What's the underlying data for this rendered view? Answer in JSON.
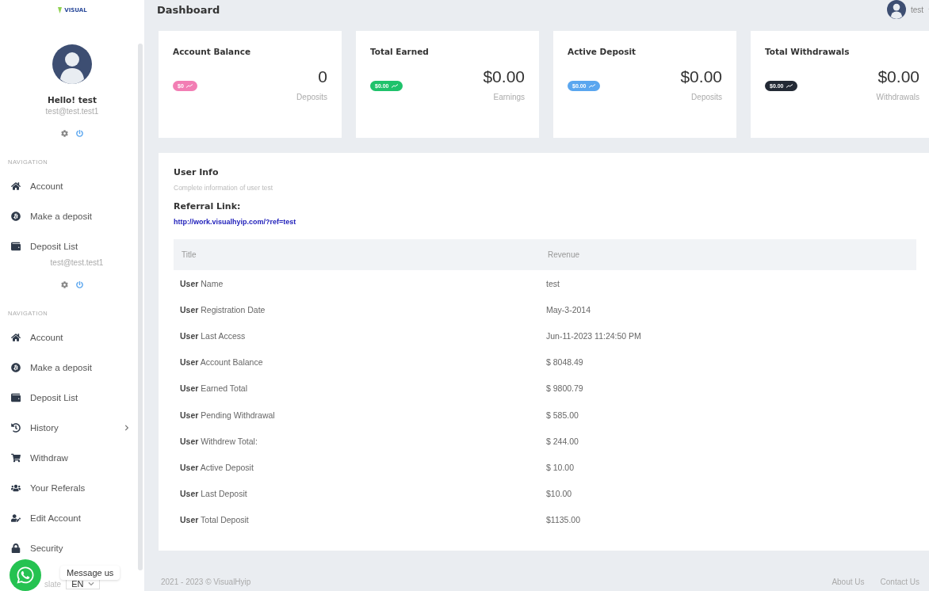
{
  "sidebar": {
    "logo": "VISUAL",
    "blocks": [
      {
        "kind": "profile",
        "greeting": "Hello! test",
        "email": "test@test.test1"
      },
      {
        "kind": "actions"
      },
      {
        "kind": "heading",
        "text": "NAVIGATION"
      },
      {
        "kind": "item",
        "label": "Account"
      },
      {
        "kind": "item",
        "label": "Make a deposit"
      },
      {
        "kind": "item",
        "label": "Deposit List"
      },
      {
        "kind": "email",
        "text": "test@test.test1"
      },
      {
        "kind": "actions"
      },
      {
        "kind": "heading",
        "text": "NAVIGATION"
      },
      {
        "kind": "item",
        "label": "Account"
      },
      {
        "kind": "item",
        "label": "Make a deposit"
      },
      {
        "kind": "item",
        "label": "Deposit List"
      },
      {
        "kind": "submenu",
        "label": "History"
      },
      {
        "kind": "item",
        "label": "Withdraw"
      },
      {
        "kind": "item",
        "label": "Your Referals"
      },
      {
        "kind": "item",
        "label": "Edit Account"
      },
      {
        "kind": "item",
        "label": "Security"
      }
    ]
  },
  "chat": {
    "message": "Message us"
  },
  "translate": {
    "label": "slate",
    "language": "EN"
  },
  "header": {
    "title": "Dashboard",
    "user": "test"
  },
  "cards": [
    {
      "title": "Account Balance",
      "badge": "$0",
      "color": "#f27eb4",
      "value": "0",
      "caption": "Deposits"
    },
    {
      "title": "Total Earned",
      "badge": "$0.00",
      "color": "#1fc26b",
      "value": "$0.00",
      "caption": "Earnings"
    },
    {
      "title": "Active Deposit",
      "badge": "$0.00",
      "color": "#5aa6ef",
      "value": "$0.00",
      "caption": "Deposits"
    },
    {
      "title": "Total Withdrawals",
      "badge": "$0.00",
      "color": "#232a35",
      "value": "$0.00",
      "caption": "Withdrawals"
    }
  ],
  "user_info": {
    "title": "User Info",
    "subtitle": "Complete information of user test",
    "referral_label": "Referral Link:",
    "referral_link": "http://work.visualhyip.com/?ref=test",
    "columns": [
      "Title",
      "Revenue"
    ],
    "rows": [
      [
        "**User** Name",
        "test"
      ],
      [
        "**User** Registration Date",
        "May-3-2014"
      ],
      [
        "**User** Last Access",
        "Jun-11-2023 11:24:50 PM"
      ],
      [
        "**User** Account Balance",
        "$ 8048.49"
      ],
      [
        "**User** Earned Total",
        "$ 9800.79"
      ],
      [
        "**User** Pending Withdrawal",
        "$ 585.00"
      ],
      [
        "**User** Withdrew Total:",
        "$ 244.00"
      ],
      [
        "**User** Active Deposit",
        "$ 10.00"
      ],
      [
        "**User** Last Deposit",
        "$10.00"
      ],
      [
        "**User** Total Deposit",
        "$1135.00"
      ]
    ]
  },
  "footer": {
    "copyright": "2021 - 2023 © VisualHyip",
    "links": [
      "About Us",
      "Contact Us"
    ]
  }
}
